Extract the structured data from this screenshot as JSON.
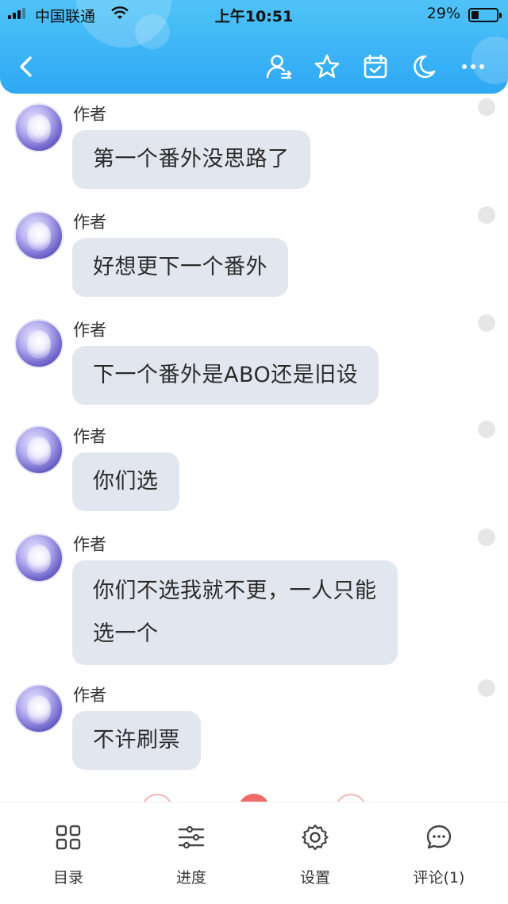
{
  "status_bar": {
    "carrier": "中国联通",
    "time": "上午10:51",
    "battery_percent": "29%",
    "battery_level": 0.29
  },
  "header": {
    "icons": [
      "back-icon",
      "user-switch-icon",
      "star-icon",
      "calendar-check-icon",
      "moon-icon",
      "more-icon"
    ]
  },
  "messages": [
    {
      "author": "作者",
      "text": "第一个番外没思路了"
    },
    {
      "author": "作者",
      "text": "好想更下一个番外"
    },
    {
      "author": "作者",
      "text": "下一个番外是ABO还是旧设"
    },
    {
      "author": "作者",
      "text": "你们选"
    },
    {
      "author": "作者",
      "line1": "你们不选我就不更，一人只能",
      "line2": "选一个"
    },
    {
      "author": "作者",
      "text": "不许刷票"
    }
  ],
  "bottom_bar": {
    "tabs": [
      {
        "label": "目录",
        "icon": "grid-icon"
      },
      {
        "label": "进度",
        "icon": "sliders-icon"
      },
      {
        "label": "设置",
        "icon": "gear-icon"
      },
      {
        "label": "评论(1)",
        "icon": "comment-icon"
      }
    ]
  },
  "colors": {
    "header_gradient_top": "#4fc3f7",
    "header_gradient_bottom": "#2ea8f4",
    "bubble": "#e2e7ef",
    "accent_peek": "#f26b6b"
  }
}
